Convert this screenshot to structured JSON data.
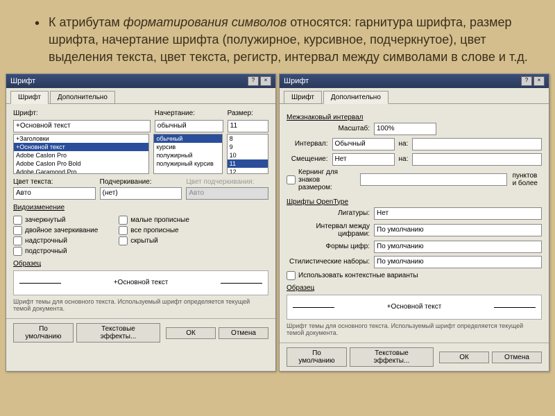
{
  "slide": {
    "bullet_prefix": "К атрибутам ",
    "bullet_italic": "форматирования символов",
    "bullet_rest": " относятся: гарнитура шрифта, размер шрифта, начертание шрифта (полужирное, курсивное, подчеркнутое), цвет выделения текста, цвет текста, регистр, интервал между символами в слове и т.д."
  },
  "dialog1": {
    "title": "Шрифт",
    "tabs": {
      "t1": "Шрифт",
      "t2": "Дополнительно"
    },
    "labels": {
      "font": "Шрифт:",
      "style": "Начертание:",
      "size": "Размер:",
      "color": "Цвет текста:",
      "underline": "Подчеркивание:",
      "ulcolor": "Цвет подчеркивания:"
    },
    "values": {
      "font": "+Основной текст",
      "style": "обычный",
      "size": "11",
      "fontlist": [
        "+Заголовки",
        "+Основной текст",
        "Adobe Caslon Pro",
        "Adobe Caslon Pro Bold",
        "Adobe Garamond Pro"
      ],
      "stylelist": [
        "обычный",
        "курсив",
        "полужирный",
        "полужирный курсив"
      ],
      "sizelist": [
        "8",
        "9",
        "10",
        "11",
        "12"
      ],
      "color": "Авто",
      "underline": "(нет)",
      "ulcolor": "Авто"
    },
    "section_effects": "Видоизменение",
    "checks_left": [
      "зачеркнутый",
      "двойное зачеркивание",
      "надстрочный",
      "подстрочный"
    ],
    "checks_right": [
      "малые прописные",
      "все прописные",
      "скрытый"
    ],
    "preview_label": "Образец",
    "preview_text": "+Основной текст",
    "hint": "Шрифт темы для основного текста. Используемый шрифт определяется текущей темой документа.",
    "buttons": {
      "default": "По умолчанию",
      "effects": "Текстовые эффекты...",
      "ok": "ОК",
      "cancel": "Отмена"
    }
  },
  "dialog2": {
    "title": "Шрифт",
    "tabs": {
      "t1": "Шрифт",
      "t2": "Дополнительно"
    },
    "section_spacing": "Межзнаковый интервал",
    "rows": {
      "scale": {
        "label": "Масштаб:",
        "value": "100%"
      },
      "spacing": {
        "label": "Интервал:",
        "value": "Обычный",
        "by": "на:"
      },
      "position": {
        "label": "Смещение:",
        "value": "Нет",
        "by": "на:"
      }
    },
    "kerning": {
      "label": "Кернинг для знаков размером:",
      "suffix": "пунктов и более"
    },
    "section_opentype": "Шрифты OpenType",
    "ot_rows": {
      "ligatures": {
        "label": "Лигатуры:",
        "value": "Нет"
      },
      "numspacing": {
        "label": "Интервал между цифрами:",
        "value": "По умолчанию"
      },
      "numforms": {
        "label": "Формы цифр:",
        "value": "По умолчанию"
      },
      "stylistic": {
        "label": "Стилистические наборы:",
        "value": "По умолчанию"
      }
    },
    "contextual": "Использовать контекстные варианты",
    "preview_label": "Образец",
    "preview_text": "+Основной текст",
    "hint": "Шрифт темы для основного текста. Используемый шрифт определяется текущей темой документа.",
    "buttons": {
      "default": "По умолчанию",
      "effects": "Текстовые эффекты...",
      "ok": "ОК",
      "cancel": "Отмена"
    }
  }
}
